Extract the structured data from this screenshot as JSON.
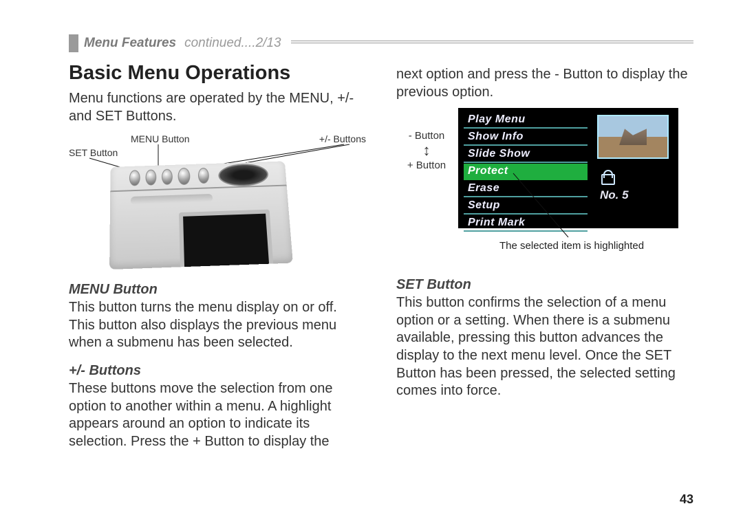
{
  "header": {
    "section": "Menu Features",
    "cont": "continued....2/13"
  },
  "left": {
    "h1": "Basic Menu Operations",
    "intro": "Menu functions are operated by the MENU, +/- and SET Buttons.",
    "camLabels": {
      "menu": "MENU Button",
      "plus": "+/- Buttons",
      "set": "SET Button"
    },
    "menuBtnH": "MENU Button",
    "menuBtnP": "This button turns the menu display on or off. This button also displays the previous menu when a submenu has been selected.",
    "plusH": "+/- Buttons",
    "plusP": "These buttons move the selection from one option to another within a menu. A highlight appears around an option to indicate its selection. Press the + Button to display the"
  },
  "right": {
    "contP": "next option and press the - Button  to display the previous option.",
    "sideMinus": "- Button",
    "sidePlus": "+ Button",
    "lcdItems": [
      "Play Menu",
      "Show Info",
      "Slide Show",
      "Protect",
      "Erase",
      "Setup",
      "Print Mark"
    ],
    "lcdNum": "No. 5",
    "caption": "The selected item is highlighted",
    "setH": "SET Button",
    "setP": "This button confirms the selection of a menu option or a setting. When there is a submenu available, pressing this button advances the display to the next menu level. Once the SET Button has been pressed, the selected setting comes into force."
  },
  "pagenum": "43"
}
